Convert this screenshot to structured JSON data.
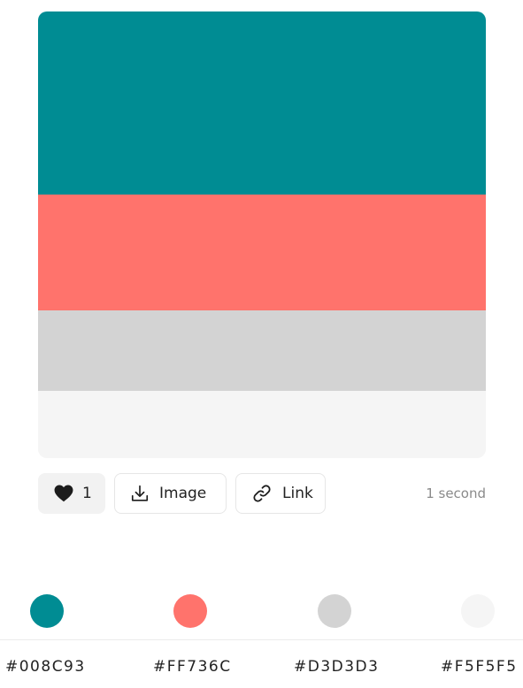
{
  "palette": {
    "colors": [
      {
        "hex": "#008C93",
        "label": "#008C93",
        "fraction": 0.41
      },
      {
        "hex": "#FF736C",
        "label": "#FF736C",
        "fraction": 0.26
      },
      {
        "hex": "#D3D3D3",
        "label": "#D3D3D3",
        "fraction": 0.18
      },
      {
        "hex": "#F5F5F5",
        "label": "#F5F5F5",
        "fraction": 0.15
      }
    ]
  },
  "actions": {
    "like_count": "1",
    "image_label": "Image",
    "link_label": "Link",
    "time_ago": "1 second"
  },
  "icons": {
    "like": "heart-icon",
    "image": "download-icon",
    "link": "link-icon"
  }
}
